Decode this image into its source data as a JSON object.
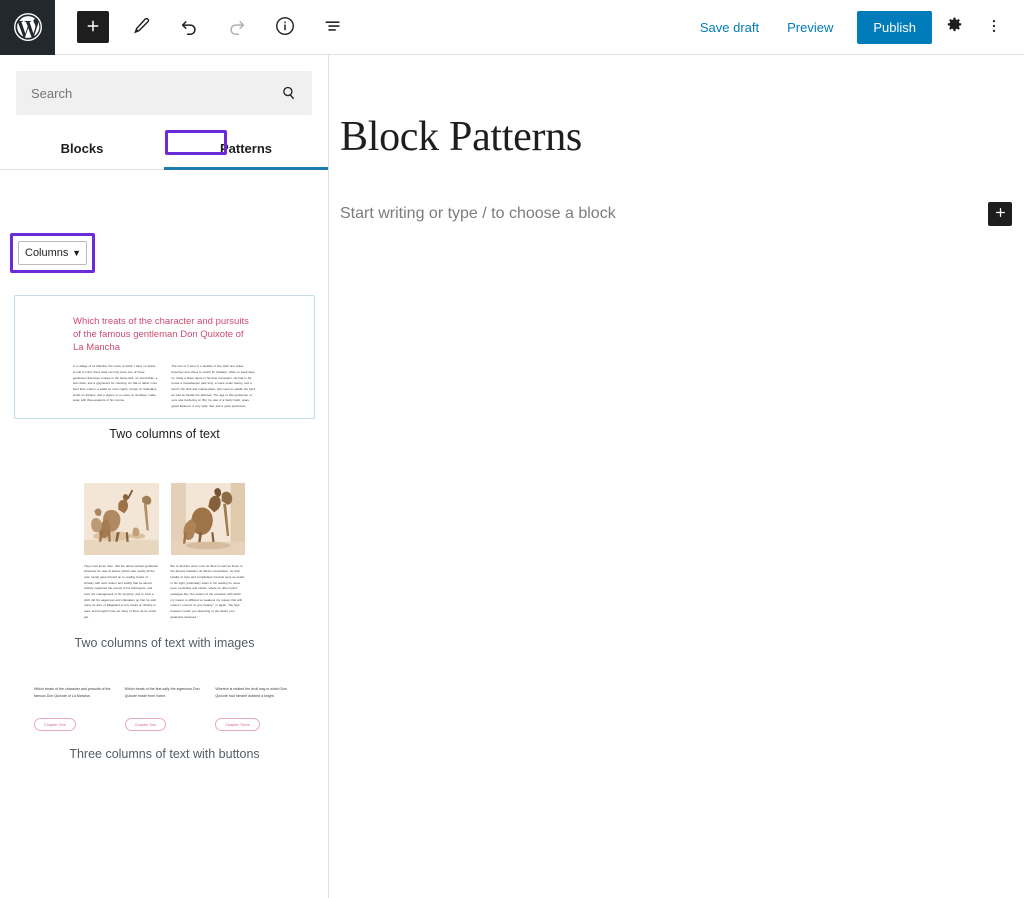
{
  "topbar": {
    "logo_icon": "wordpress-logo-icon",
    "tools": [
      {
        "icon": "plus-icon",
        "name": "add-block-toggle"
      },
      {
        "icon": "pencil-icon",
        "name": "edit-tool"
      },
      {
        "icon": "undo-arrow-icon",
        "name": "undo-button"
      },
      {
        "icon": "redo-arrow-icon",
        "name": "redo-button"
      },
      {
        "icon": "info-circle-icon",
        "name": "details-button"
      },
      {
        "icon": "list-view-icon",
        "name": "list-view-button"
      }
    ],
    "save_draft_label": "Save draft",
    "preview_label": "Preview",
    "publish_label": "Publish",
    "settings_icon": "gear-icon",
    "more_icon": "kebab-menu-icon",
    "accent_blue": "#007cba"
  },
  "sidebar": {
    "search": {
      "placeholder": "Search",
      "value": "",
      "icon": "search-icon"
    },
    "tabs": [
      {
        "label": "Blocks",
        "active": false
      },
      {
        "label": "Patterns",
        "active": true
      }
    ],
    "highlight_color": "#6c2bd9",
    "active_tab_underline_color": "#1e7bb0",
    "category_select": {
      "value": "Columns",
      "chevron_icon": "chevron-down-icon"
    },
    "patterns": [
      {
        "label": "Two columns of text",
        "selected": true,
        "heading": "Which treats of the character and pursuits of the famous gentleman Don Quixote of La Mancha",
        "heading_color": "#cf4b6f",
        "columns": [
          "In a village of La Mancha, the name of which I have no desire to call to mind, there lived not long since one of those gentlemen that keep a lance in the lance-rack, an old buckler, a lean hack, and a greyhound for coursing. An olla of rather more beef than mutton, a salad on most nights, scraps on Saturdays, lentils on Fridays, and a pigeon or so extra on Sundays, made away with three-quarters of his income.",
          "The rest of it went in a doublet of fine cloth and velvet breeches and shoes to match for holidays, while on week-days he made a brave figure in his best homespun. He had in his house a housekeeper past forty, a niece under twenty, and a lad for the field and market-place, who used to saddle the hack as well as handle the bill-hook. The age of this gentleman of ours was bordering on fifty; he was of a hardy habit, spare, gaunt-featured, a very early riser and a great sportsman."
        ]
      },
      {
        "label": "Two columns of text with images",
        "selected": false,
        "columns": [
          "They must know, then, that the above-named gentleman whenever he was at leisure (which was mostly all the year round) gave himself up to reading books of chivalry with such ardour and avidity that he almost entirely neglected the pursuit of his field-sports, and even the management of his property; and to such a pitch did his eagerness and infatuation go that he sold many an acre of tillageland to buy books of chivalry to read, and brought home as many of them as he could get.",
          "But of all there were none he liked so well as those of the famous Feliciano de Silva's composition, for their lucidity of style and complicated conceits were as pearls in his sight, particularly when in his reading he came upon courtships and cartels, where he often found passages like \"the reason of the unreason with which my reason is afflicted so weakens my reason that with reason I murmur at your beauty;\" or again, \"the high heavens render you deserving of the desert your greatness deserves.\""
        ],
        "images": [
          "don-quixote-illustration-one",
          "don-quixote-illustration-two"
        ]
      },
      {
        "label": "Three columns of text with buttons",
        "selected": false,
        "columns": [
          "Which treats of the character and pursuits of the famous Don Quixote of La Mancha.",
          "Which treats of the first sally the ingenious Don Quixote made from home.",
          "Wherein is related the droll way in which Don Quixote had himself dubbed a knight."
        ],
        "buttons": [
          "Chapter One",
          "Chapter Two",
          "Chapter Three"
        ],
        "button_color": "#d66a8c"
      }
    ]
  },
  "editor": {
    "title": "Block Patterns",
    "paragraph_placeholder": "Start writing or type / to choose a block",
    "add_block_icon": "plus-icon"
  }
}
